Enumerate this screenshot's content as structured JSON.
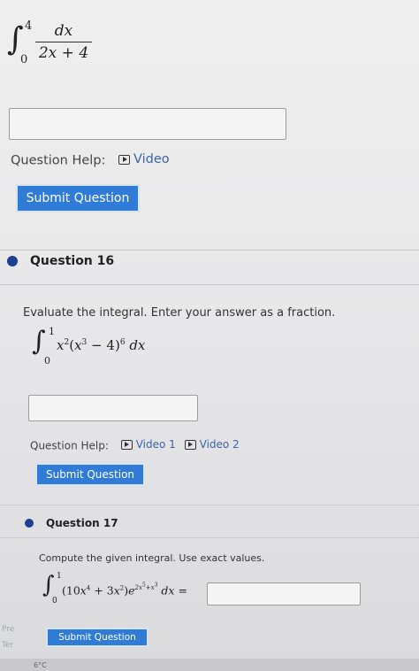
{
  "top_problem": {
    "integral_upper": "4",
    "integral_lower": "0",
    "numerator": "dx",
    "denominator": "2x + 4"
  },
  "q15": {
    "help_label": "Question Help:",
    "video_label": "Video",
    "submit_label": "Submit Question"
  },
  "q16": {
    "title": "Question 16",
    "prompt": "Evaluate the integral. Enter your answer as a fraction.",
    "integral_upper": "1",
    "integral_lower": "0",
    "help_label": "Question Help:",
    "video1_label": "Video 1",
    "video2_label": "Video 2",
    "submit_label": "Submit Question"
  },
  "q17": {
    "title": "Question 17",
    "prompt": "Compute the given integral. Use exact values.",
    "integral_upper": "1",
    "integral_lower": "0",
    "submit_label": "Submit Question"
  },
  "side": {
    "stub_top": "Pre",
    "stub_bottom": "Ter"
  },
  "taskbar": {
    "temperature": "6°C"
  },
  "colors": {
    "accent_button": "#2f7bd6",
    "bullet": "#1c3f8f",
    "link": "#3a64a8"
  }
}
